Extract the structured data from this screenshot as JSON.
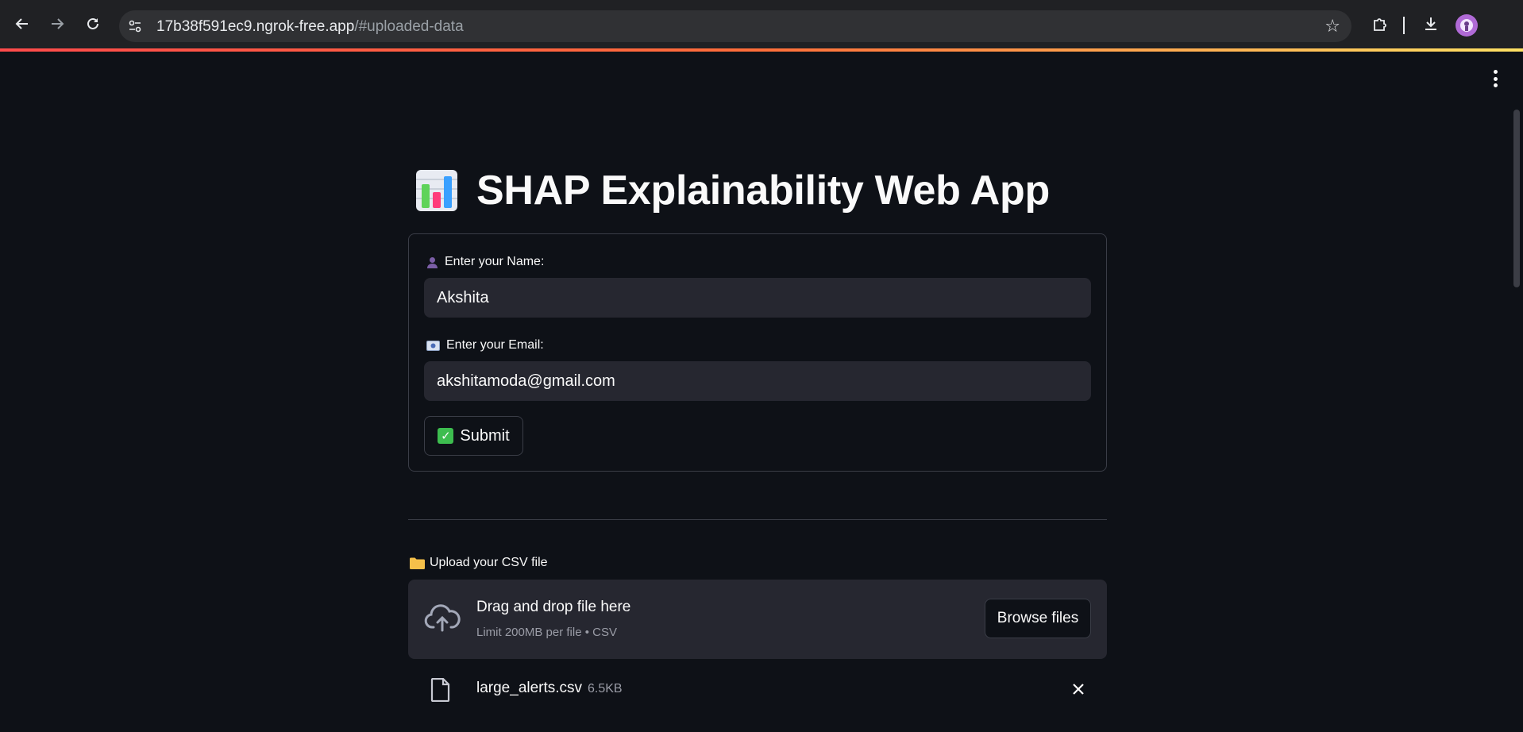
{
  "browser": {
    "url_host": "17b38f591ec9.ngrok-free.app",
    "url_path": "/#uploaded-data"
  },
  "app": {
    "title": "SHAP Explainability Web App"
  },
  "form": {
    "name_label": "Enter your Name:",
    "name_value": "Akshita",
    "email_label": "Enter your Email:",
    "email_value": "akshitamoda@gmail.com",
    "submit_label": "Submit"
  },
  "upload": {
    "label": "Upload your CSV file",
    "dropzone_title": "Drag and drop file here",
    "dropzone_sub": "Limit 200MB per file • CSV",
    "browse_label": "Browse files",
    "file_name": "large_alerts.csv",
    "file_size": "6.5KB"
  },
  "colors": {
    "background": "#0e1117",
    "input_bg": "#262730",
    "border": "#3a3d47",
    "accent_gradient_start": "#ff4b4b",
    "accent_gradient_end": "#ffe164"
  }
}
